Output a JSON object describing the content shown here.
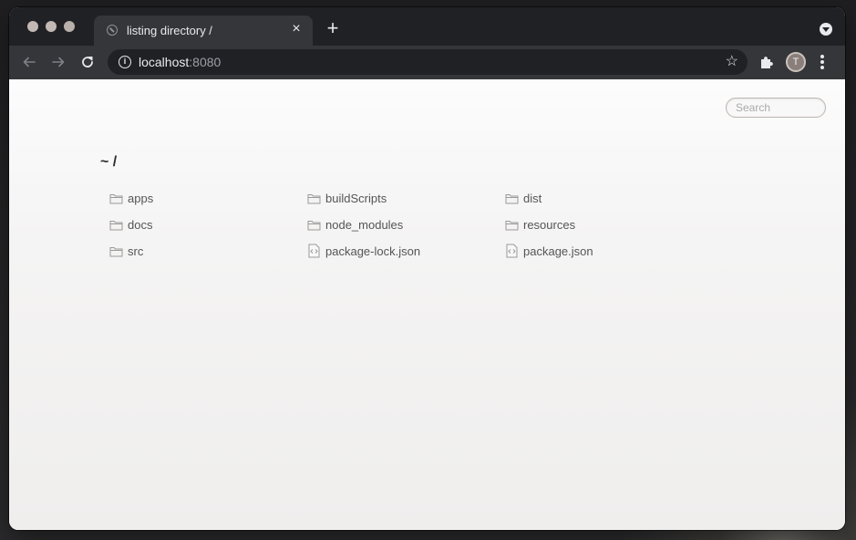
{
  "browser": {
    "tab": {
      "title": "listing directory /",
      "close_label": "×"
    },
    "new_tab_label": "+",
    "address_bar": {
      "host": "localhost",
      "port": ":8080",
      "info_label": "i",
      "star_label": "☆"
    },
    "profile_initial": "T"
  },
  "page": {
    "search": {
      "placeholder": "Search",
      "value": ""
    },
    "heading": "~ /",
    "files": [
      {
        "name": "apps",
        "icon": "folder-icon"
      },
      {
        "name": "buildScripts",
        "icon": "folder-icon"
      },
      {
        "name": "dist",
        "icon": "folder-icon"
      },
      {
        "name": "docs",
        "icon": "folder-icon"
      },
      {
        "name": "node_modules",
        "icon": "folder-icon"
      },
      {
        "name": "resources",
        "icon": "folder-icon"
      },
      {
        "name": "src",
        "icon": "folder-icon"
      },
      {
        "name": "package-lock.json",
        "icon": "code-file-icon"
      },
      {
        "name": "package.json",
        "icon": "code-file-icon"
      }
    ]
  },
  "colors": {
    "tabstrip": "#202124",
    "toolbar": "#35363a",
    "page_background": "#f2f1f0",
    "file_text": "#555555",
    "icon_stroke": "#9a9a9a"
  }
}
